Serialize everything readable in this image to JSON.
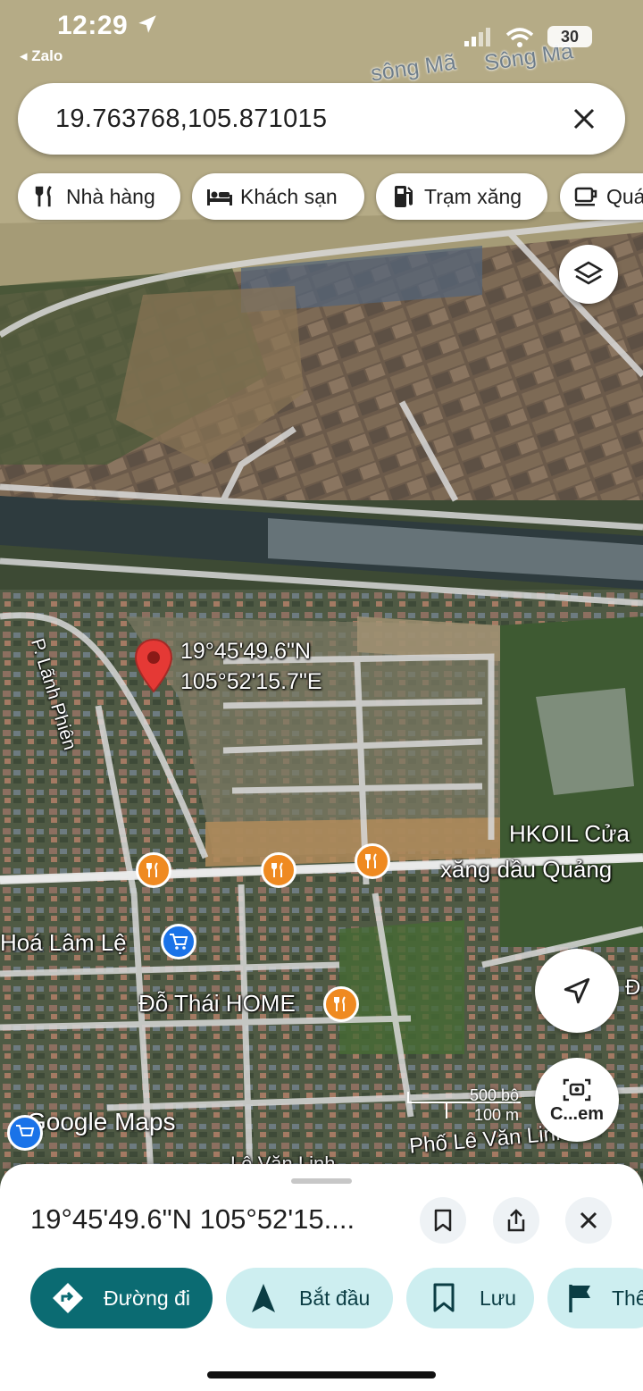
{
  "status_bar": {
    "time": "12:29",
    "back_app": "Zalo",
    "battery": "30"
  },
  "search": {
    "query": "19.763768,105.871015"
  },
  "chips": [
    {
      "label": "Nhà hàng",
      "icon": "restaurant-icon"
    },
    {
      "label": "Khách sạn",
      "icon": "hotel-icon"
    },
    {
      "label": "Trạm xăng",
      "icon": "gas-station-icon"
    },
    {
      "label": "Quán cà phê",
      "icon": "coffee-icon"
    }
  ],
  "map": {
    "river_labels": [
      "sông Mã",
      "Sông Mã"
    ],
    "street_label": "P. Lãnh Phiên",
    "pin_coords": {
      "lat": "19°45'49.6\"N",
      "lng": "105°52'15.7\"E"
    },
    "places": {
      "hkoil_line1": "HKOIL Cửa",
      "hkoil_line2": "xăng dầu Quảng",
      "hoa_lam_le": "Hoá Lâm Lệ",
      "do_thai_home": "Đỗ Thái HOME",
      "pho_le_van_linh": "Phố Lê Văn Linh",
      "pho_le_van_linh_2": "Lê Văn Linh",
      "cut_right": "Đ"
    },
    "scale": {
      "top": "500 bộ",
      "bottom": "100 m"
    },
    "attribution": "Google Maps",
    "lens_label": "C...em"
  },
  "sheet": {
    "title": "19°45'49.6\"N 105°52'15....",
    "actions": [
      {
        "label": "Đường đi",
        "icon": "directions-icon"
      },
      {
        "label": "Bắt đầu",
        "icon": "navigate-icon"
      },
      {
        "label": "Lưu",
        "icon": "bookmark-icon"
      },
      {
        "label": "Thêm",
        "icon": "flag-icon"
      }
    ]
  },
  "colors": {
    "primary_action": "#0b6b72",
    "secondary_action": "#cdeef0",
    "pin": "#e53935",
    "poi_food": "#ef8a21",
    "poi_shop": "#1a73e8"
  }
}
